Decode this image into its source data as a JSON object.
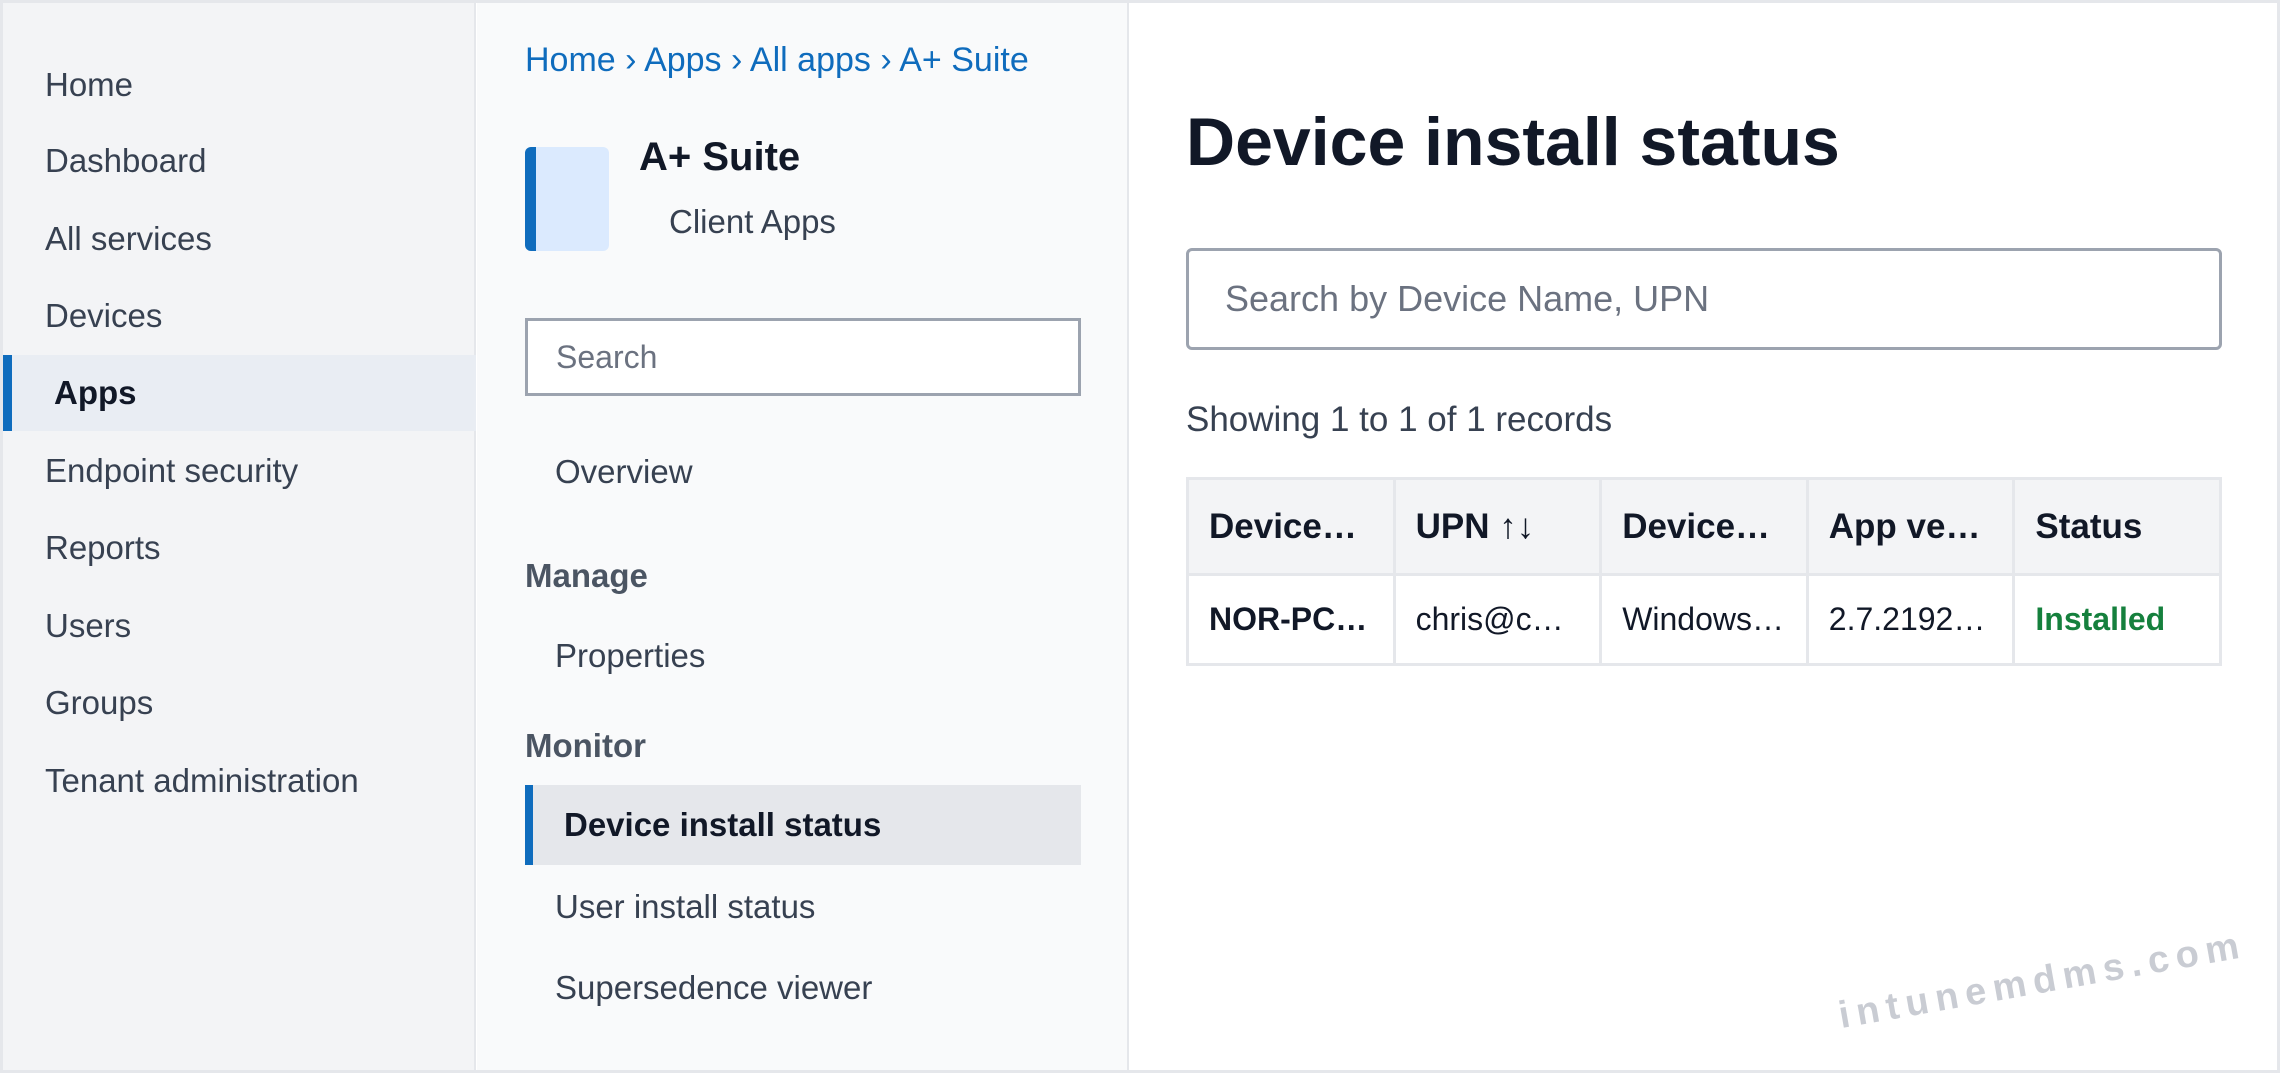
{
  "leftnav": {
    "items": [
      {
        "label": "Home"
      },
      {
        "label": "Dashboard"
      },
      {
        "label": "All services"
      },
      {
        "label": "Devices"
      },
      {
        "label": "Apps"
      },
      {
        "label": "Endpoint security"
      },
      {
        "label": "Reports"
      },
      {
        "label": "Users"
      },
      {
        "label": "Groups"
      },
      {
        "label": "Tenant administration"
      }
    ],
    "active": "Apps"
  },
  "breadcrumb": {
    "items": [
      "Home",
      "Apps",
      "All apps",
      "A+ Suite"
    ],
    "separator": "›"
  },
  "app": {
    "title": "A+ Suite",
    "subtitle": "Client Apps"
  },
  "blade": {
    "search_placeholder": "Search",
    "overview": "Overview",
    "manage_label": "Manage",
    "properties": "Properties",
    "monitor_label": "Monitor",
    "device_install_status": "Device install status",
    "user_install_status": "User install status",
    "supersedence_viewer": "Supersedence viewer",
    "active": "Device install status"
  },
  "main": {
    "title": "Device install status",
    "search_placeholder": "Search by Device Name, UPN",
    "records_text": "Showing 1 to 1 of 1 records"
  },
  "table": {
    "columns": [
      "Device…",
      "UPN ↑↓",
      "Device…",
      "App ve…",
      "Status"
    ],
    "rows": [
      [
        "NOR-PC…",
        "chris@c…",
        "Windows…",
        "2.7.2192…",
        "Installed"
      ]
    ]
  },
  "colors": {
    "accent": "#0f6cbd",
    "status_installed": "#15803d"
  },
  "watermark": "intunemdms.com"
}
